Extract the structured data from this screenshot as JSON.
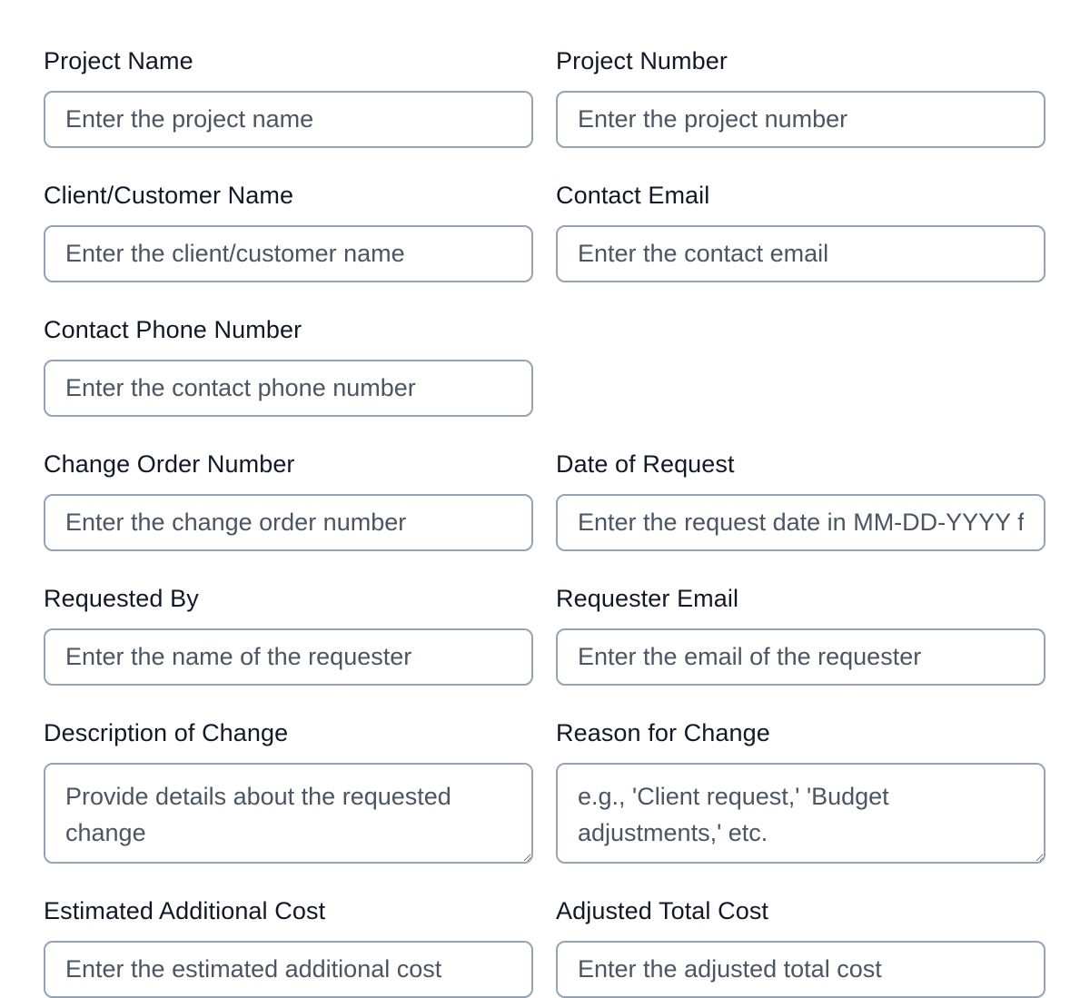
{
  "form": {
    "fields": [
      {
        "label": "Project Name",
        "placeholder": "Enter the project name"
      },
      {
        "label": "Project Number",
        "placeholder": "Enter the project number"
      },
      {
        "label": "Client/Customer Name",
        "placeholder": "Enter the client/customer name"
      },
      {
        "label": "Contact Email",
        "placeholder": "Enter the contact email"
      },
      {
        "label": "Contact Phone Number",
        "placeholder": "Enter the contact phone number"
      },
      {
        "label": "Change Order Number",
        "placeholder": "Enter the change order number"
      },
      {
        "label": "Date of Request",
        "placeholder": "Enter the request date in MM-DD-YYYY format"
      },
      {
        "label": "Requested By",
        "placeholder": "Enter the name of the requester"
      },
      {
        "label": "Requester Email",
        "placeholder": "Enter the email of the requester"
      },
      {
        "label": "Description of Change",
        "placeholder": "Provide details about the requested change"
      },
      {
        "label": "Reason for Change",
        "placeholder": "e.g., 'Client request,' 'Budget adjustments,' etc."
      },
      {
        "label": "Estimated Additional Cost",
        "placeholder": "Enter the estimated additional cost"
      },
      {
        "label": "Adjusted Total Cost",
        "placeholder": "Enter the adjusted total cost"
      }
    ]
  }
}
